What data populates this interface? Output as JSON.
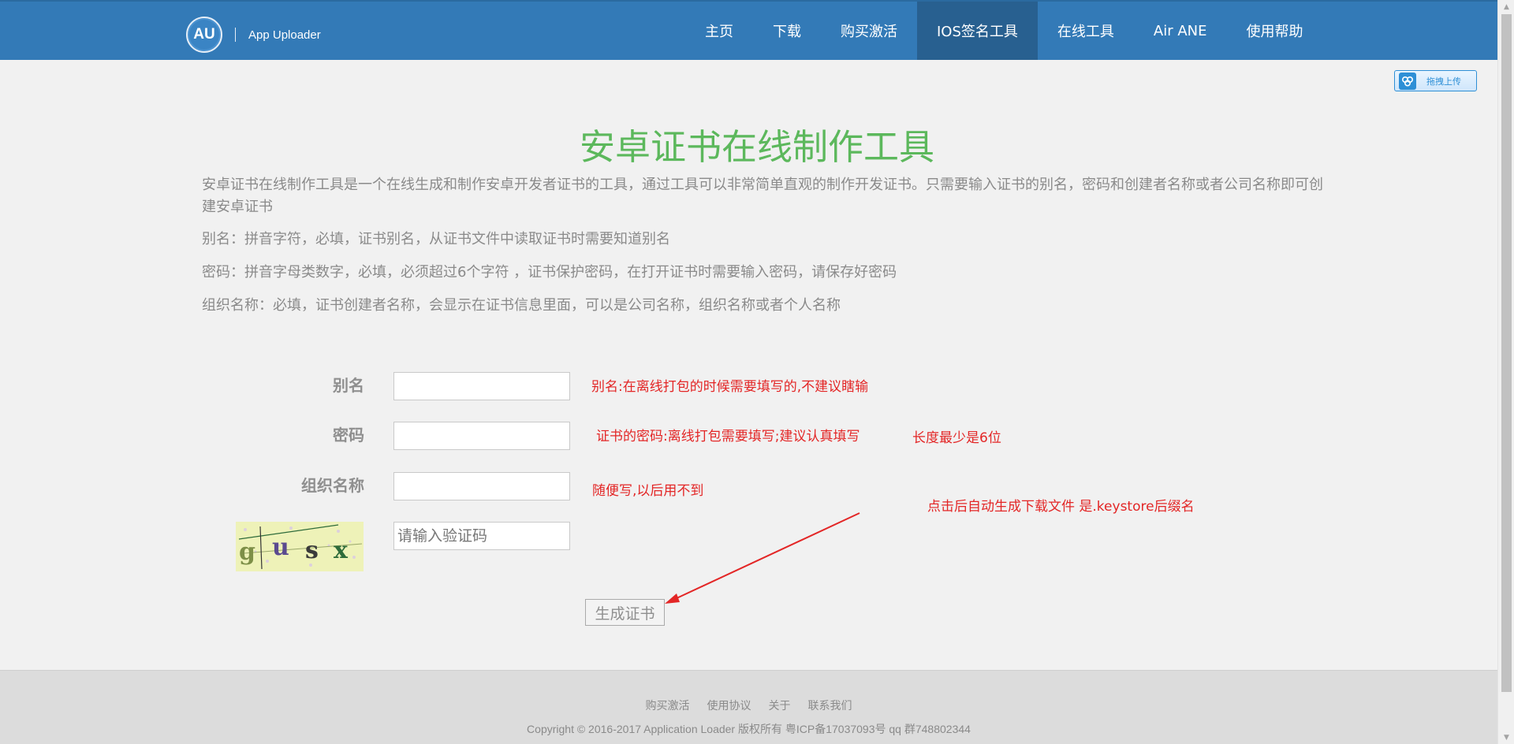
{
  "header": {
    "logo_text": "AU",
    "brand_name": "App Uploader",
    "nav": [
      {
        "label": "主页"
      },
      {
        "label": "下载"
      },
      {
        "label": "购买激活"
      },
      {
        "label": "IOS签名工具",
        "active": true
      },
      {
        "label": "在线工具"
      },
      {
        "label": "Air ANE"
      },
      {
        "label": "使用帮助"
      }
    ]
  },
  "upload_badge": {
    "label": "拖拽上传",
    "icon": "cloud-icon"
  },
  "page": {
    "title": "安卓证书在线制作工具",
    "description": "安卓证书在线制作工具是一个在线生成和制作安卓开发者证书的工具，通过工具可以非常简单直观的制作开发证书。只需要输入证书的别名，密码和创建者名称或者公司名称即可创建安卓证书",
    "alias_help": "别名：拼音字符，必填，证书别名，从证书文件中读取证书时需要知道别名",
    "password_help": "密码：拼音字母类数字，必填，必须超过6个字符 ，证书保护密码，在打开证书时需要输入密码，请保存好密码",
    "org_help": "组织名称：必填，证书创建者名称，会显示在证书信息里面，可以是公司名称，组织名称或者个人名称"
  },
  "form": {
    "alias_label": "别名",
    "alias_value": "",
    "password_label": "密码",
    "password_value": "",
    "org_label": "组织名称",
    "org_value": "",
    "captcha_text": "gusx",
    "captcha_placeholder": "请输入验证码",
    "submit_label": "生成证书"
  },
  "annotations": {
    "alias_note": "别名:在离线打包的时候需要填写的,不建议瞎输",
    "password_note": "证书的密码:离线打包需要填写;建议认真填写",
    "password_length_note": "长度最少是6位",
    "org_note": "随便写,以后用不到",
    "submit_note": "点击后自动生成下载文件 是.keystore后缀名",
    "color": "#e32626"
  },
  "footer": {
    "links": [
      "购买激活",
      "使用协议",
      "关于",
      "联系我们"
    ],
    "copyright": "Copyright © 2016-2017 Application Loader 版权所有 粤ICP备17037093号 qq 群748802344"
  },
  "colors": {
    "nav_bg": "#337ab7",
    "nav_active": "#286090",
    "title": "#5cb85c",
    "annotation": "#e32626"
  }
}
